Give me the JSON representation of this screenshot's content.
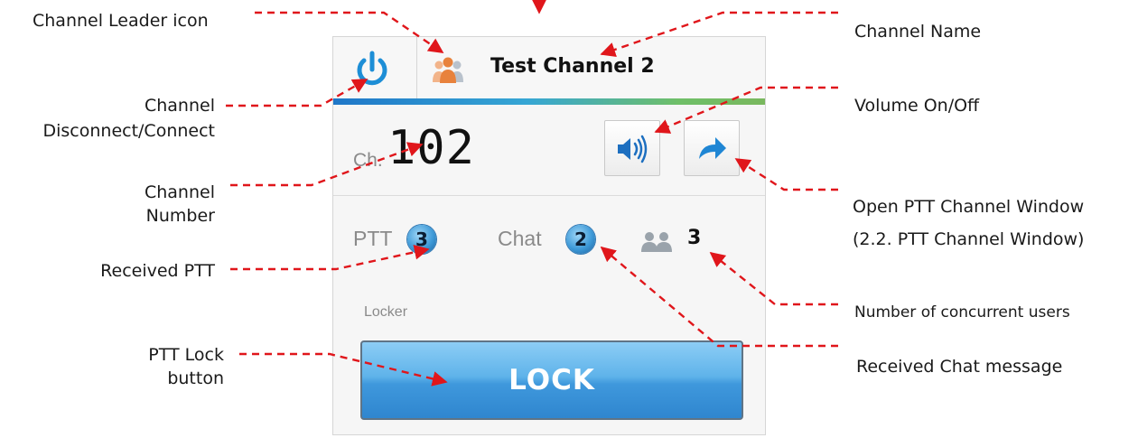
{
  "callouts": {
    "channel_leader_icon": "Channel Leader icon",
    "channel_name": "Channel Name",
    "channel_connect_line1": "Channel",
    "channel_connect_line2": "Disconnect/Connect",
    "volume": "Volume On/Off",
    "channel_number_line1": "Channel",
    "channel_number_line2": "Number",
    "open_ptt_line1": "Open PTT Channel Window",
    "open_ptt_line2": "(2.2. PTT Channel Window)",
    "received_ptt": "Received PTT",
    "concurrent_users": "Number of concurrent users",
    "ptt_lock_line1": "PTT Lock",
    "ptt_lock_line2": "button",
    "received_chat": "Received Chat message"
  },
  "widget": {
    "channel_name": "Test Channel 2",
    "channel_prefix": "Ch.",
    "channel_number": "102",
    "ptt_label": "PTT",
    "ptt_count": "3",
    "chat_label": "Chat",
    "chat_count": "2",
    "user_count": "3",
    "locker_label": "Locker",
    "lock_button": "LOCK"
  },
  "icons": [
    "power-icon",
    "channel-leader-icon",
    "volume-icon",
    "share-arrow-icon",
    "users-icon"
  ],
  "colors": {
    "callout_red": "#e0161b",
    "lock_blue": "#3f98dc",
    "badge_blue": "#3e9ad8",
    "leader_orange": "#e8823c",
    "power_blue": "#1d8ed6"
  }
}
